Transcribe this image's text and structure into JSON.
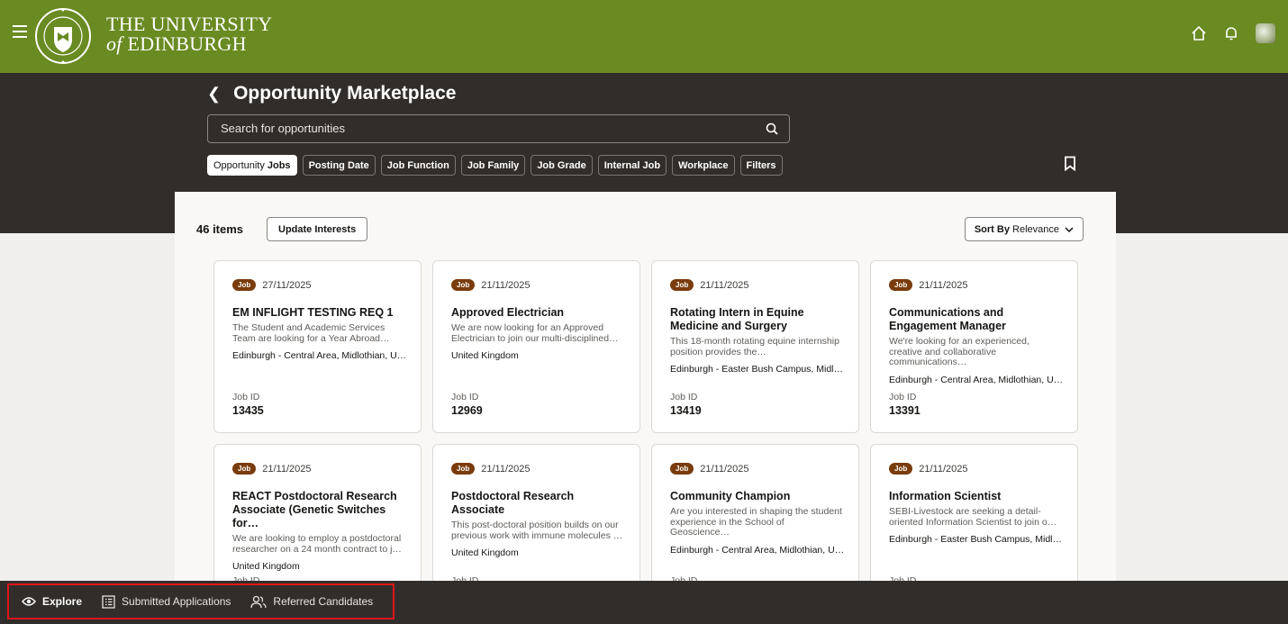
{
  "header": {
    "brand_line1": "THE UNIVERSITY",
    "brand_line2_of": "of",
    "brand_line2_name": " EDINBURGH",
    "crest_text": "THE UNIVERSITY OF EDINBURGH"
  },
  "page": {
    "title": "Opportunity Marketplace",
    "search_placeholder": "Search for opportunities"
  },
  "filters": {
    "selected_prefix": "Opportunity",
    "selected_label": "Jobs",
    "chips": [
      "Posting Date",
      "Job Function",
      "Job Family",
      "Job Grade",
      "Internal Job",
      "Workplace",
      "Filters"
    ]
  },
  "results": {
    "count": "46 items",
    "update_label": "Update Interests",
    "sort_prefix": "Sort By",
    "sort_value": "Relevance"
  },
  "cards": [
    {
      "badge": "Job",
      "date": "27/11/2025",
      "title": "EM INFLIGHT TESTING REQ 1",
      "desc": "The Student and Academic Services Team are looking for a Year Abroad…",
      "location": "Edinburgh - Central Area, Midlothian, U…",
      "id_label": "Job ID",
      "id": "13435"
    },
    {
      "badge": "Job",
      "date": "21/11/2025",
      "title": "Approved Electrician",
      "desc": "We are now looking for an Approved Electrician to join our multi-disciplined…",
      "location": "United Kingdom",
      "id_label": "Job ID",
      "id": "12969"
    },
    {
      "badge": "Job",
      "date": "21/11/2025",
      "title": "Rotating Intern in Equine Medicine and Surgery",
      "desc": "This 18-month rotating equine internship position provides the…",
      "location": "Edinburgh - Easter Bush Campus, Midl…",
      "id_label": "Job ID",
      "id": "13419"
    },
    {
      "badge": "Job",
      "date": "21/11/2025",
      "title": "Communications and Engagement Manager",
      "desc": "We're looking for an experienced, creative and collaborative communications…",
      "location": "Edinburgh - Central Area, Midlothian, U…",
      "id_label": "Job ID",
      "id": "13391"
    },
    {
      "badge": "Job",
      "date": "21/11/2025",
      "title": "REACT Postdoctoral Research Associate (Genetic Switches for…",
      "desc": "We are looking to employ a postdoctoral researcher on a 24 month contract to j…",
      "location": "United Kingdom",
      "id_label": "Job ID",
      "id": ""
    },
    {
      "badge": "Job",
      "date": "21/11/2025",
      "title": "Postdoctoral Research Associate",
      "desc": "This post-doctoral position builds on our previous work with immune molecules …",
      "location": "United Kingdom",
      "id_label": "Job ID",
      "id": ""
    },
    {
      "badge": "Job",
      "date": "21/11/2025",
      "title": "Community Champion",
      "desc": "Are you interested in shaping the student experience in the School of Geoscience…",
      "location": "Edinburgh - Central Area, Midlothian, U…",
      "id_label": "Job ID",
      "id": ""
    },
    {
      "badge": "Job",
      "date": "21/11/2025",
      "title": "Information Scientist",
      "desc": "SEBI-Livestock are seeking a detail-oriented Information Scientist to join o…",
      "location": "Edinburgh - Easter Bush Campus, Midl…",
      "id_label": "Job ID",
      "id": ""
    }
  ],
  "bottom_nav": {
    "explore": "Explore",
    "submitted": "Submitted Applications",
    "referred": "Referred Candidates"
  },
  "colors": {
    "brand_green": "#6a8a22",
    "dark": "#312d2a",
    "badge": "#7a3c0c",
    "highlight": "#e0141c"
  },
  "icons": [
    "menu-icon",
    "crest-logo",
    "home-icon",
    "bell-icon",
    "user-avatar",
    "back-icon",
    "search-icon",
    "bookmark-icon",
    "chevron-down-icon",
    "eye-icon",
    "list-icon",
    "people-icon"
  ]
}
